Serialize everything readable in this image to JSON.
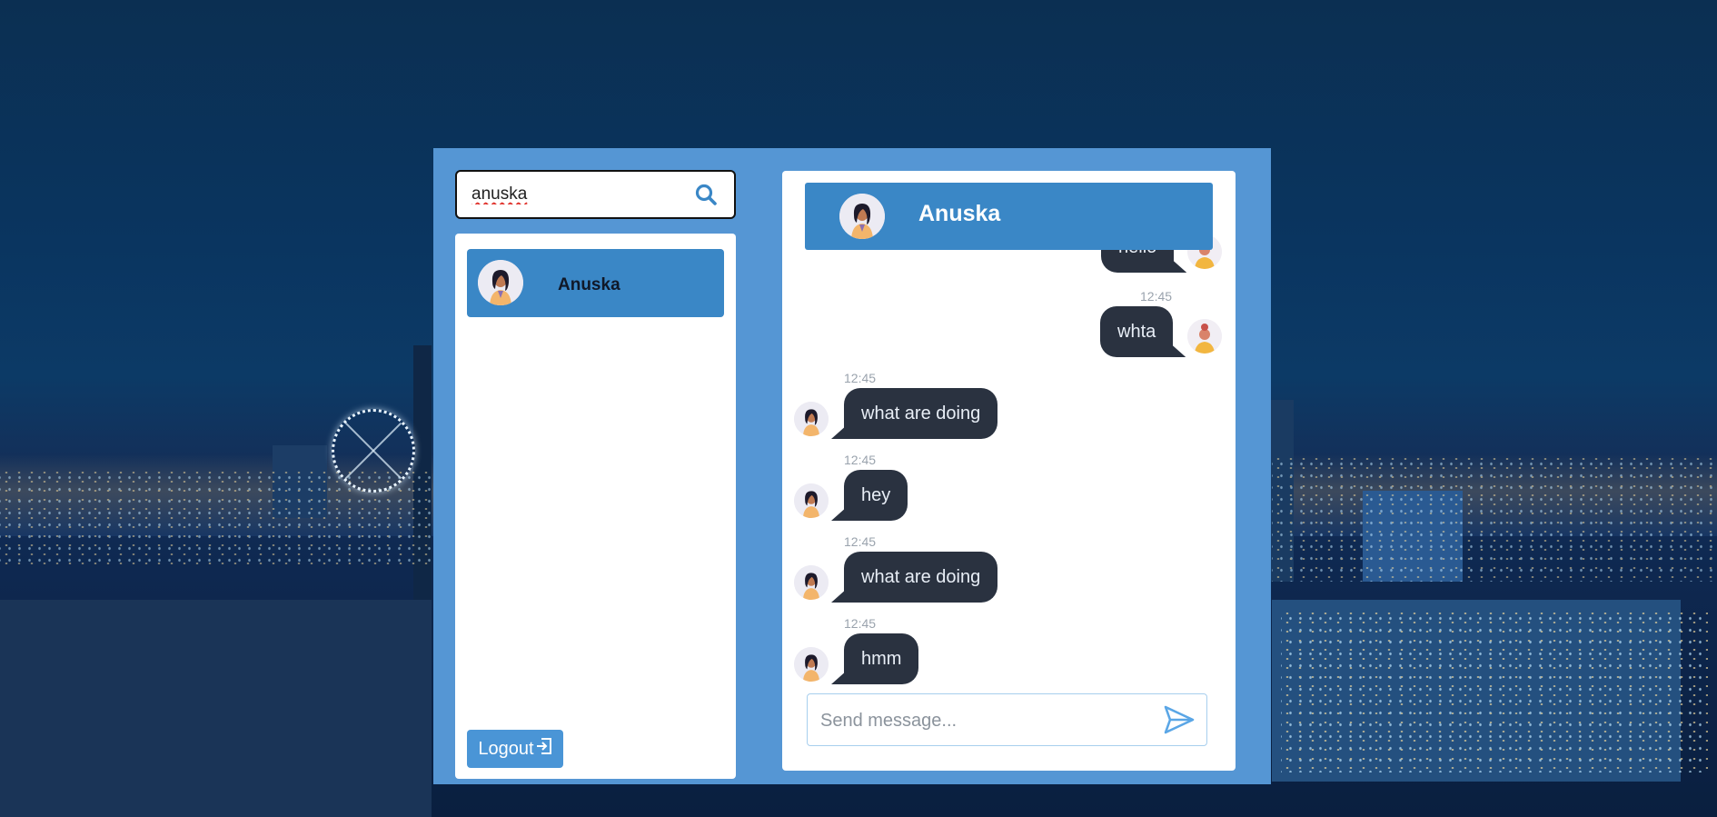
{
  "search": {
    "value": "anuska",
    "icon": "search-icon"
  },
  "contacts": [
    {
      "name": "Anuska",
      "avatar": "female-avatar"
    }
  ],
  "logout": {
    "label": "Logout",
    "icon": "logout-icon"
  },
  "chat": {
    "title": "Anuska",
    "messages": [
      {
        "text": "hello",
        "direction": "out",
        "time": ""
      },
      {
        "text": "whta",
        "direction": "out",
        "time": "12:45"
      },
      {
        "text": "what are doing",
        "direction": "in",
        "time": "12:45"
      },
      {
        "text": "hey",
        "direction": "in",
        "time": "12:45"
      },
      {
        "text": "what are doing",
        "direction": "in",
        "time": "12:45"
      },
      {
        "text": "hmm",
        "direction": "in",
        "time": "12:45"
      }
    ],
    "composer_placeholder": "Send message...",
    "send_icon": "send-icon"
  },
  "colors": {
    "panel": "#5596d4",
    "accent": "#3a87c6",
    "bubble": "#2a3240"
  }
}
